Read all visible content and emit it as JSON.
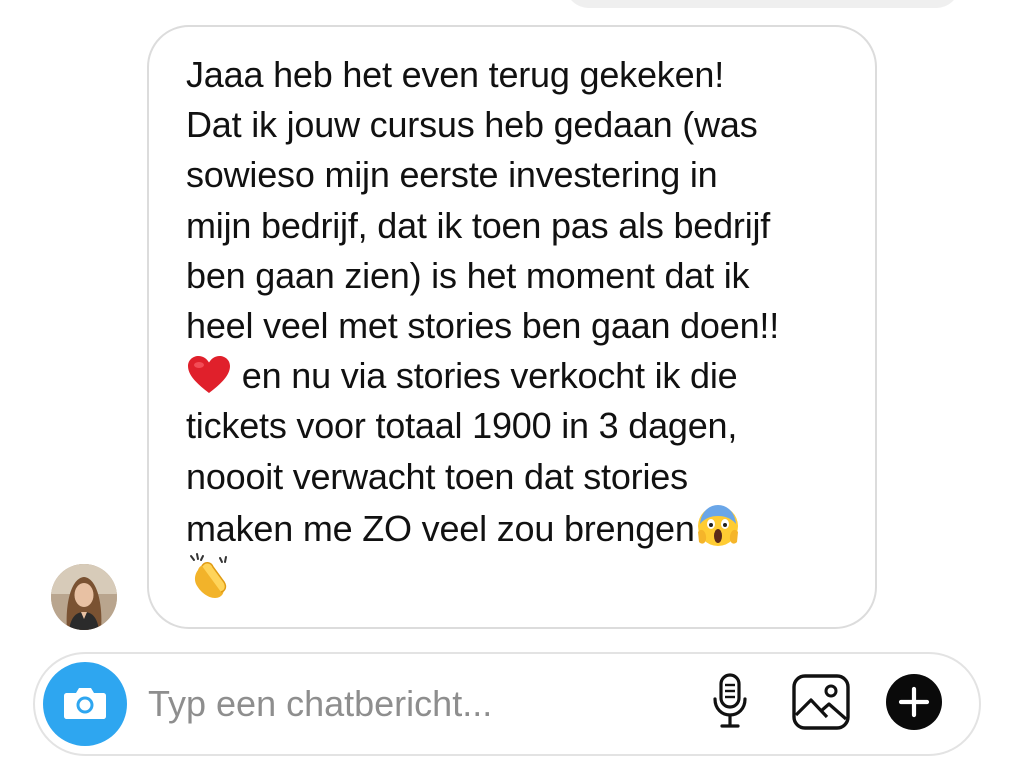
{
  "message": {
    "lines": [
      "Jaaa heb het even terug gekeken!",
      "Dat ik jouw cursus heb gedaan (was",
      "sowieso mijn eerste investering in",
      "mijn bedrijf, dat ik toen pas als bedrijf",
      "ben gaan zien) is het moment dat ik",
      "heel veel met stories ben gaan doen!!",
      " en nu via stories verkocht ik die",
      "tickets voor totaal 1900 in 3 dagen,",
      "noooit verwacht toen dat stories",
      "maken me ZO veel zou brengen"
    ],
    "emojis": [
      "red-heart",
      "face-screaming-in-fear",
      "clapping-hands"
    ]
  },
  "composer": {
    "placeholder": "Typ een chatbericht...",
    "value": ""
  },
  "icons": {
    "camera": "camera-icon",
    "mic": "microphone-icon",
    "gallery": "image-gallery-icon",
    "add": "plus-circle-icon"
  },
  "colors": {
    "camera_button": "#2ea6f0",
    "bubble_border": "#dcdcdc",
    "placeholder": "#8e8e8e"
  }
}
